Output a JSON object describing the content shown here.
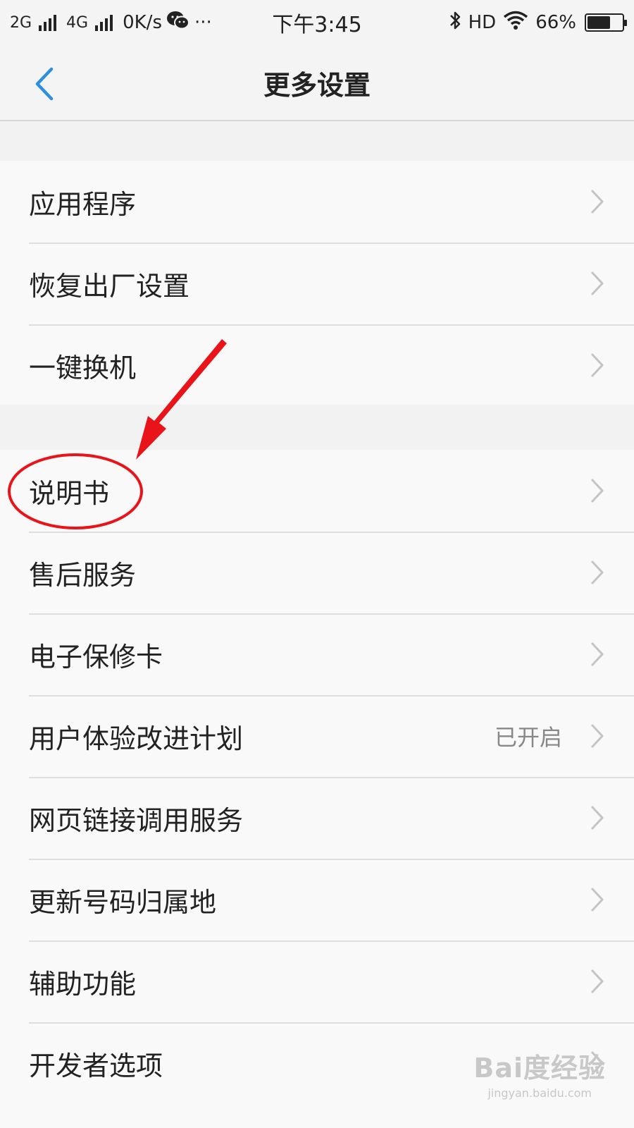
{
  "status_bar": {
    "net1": "2G",
    "net2": "4G",
    "speed": "0K/s",
    "more": "···",
    "time": "下午3:45",
    "hd": "HD",
    "battery_text": "66%",
    "battery_level": 0.66,
    "icons": [
      "signal-icon",
      "wechat-icon",
      "bluetooth-icon",
      "wifi-icon",
      "battery-icon"
    ]
  },
  "header": {
    "title": "更多设置",
    "back_icon": "chevron-left-icon",
    "accent_color": "#2f8fdc"
  },
  "group1": {
    "items": [
      {
        "label": "应用程序",
        "value": ""
      },
      {
        "label": "恢复出厂设置",
        "value": ""
      },
      {
        "label": "一键换机",
        "value": ""
      }
    ]
  },
  "group2": {
    "items": [
      {
        "label": "说明书",
        "value": ""
      },
      {
        "label": "售后服务",
        "value": ""
      },
      {
        "label": "电子保修卡",
        "value": ""
      },
      {
        "label": "用户体验改进计划",
        "value": "已开启"
      },
      {
        "label": "网页链接调用服务",
        "value": ""
      },
      {
        "label": "更新号码归属地",
        "value": ""
      },
      {
        "label": "辅助功能",
        "value": ""
      },
      {
        "label": "开发者选项",
        "value": ""
      }
    ]
  },
  "annotation": {
    "color": "#e8141a",
    "shapes": [
      "arrow",
      "circle"
    ]
  },
  "watermark": {
    "brand": "Bai度经验",
    "url": "jingyan.baidu.com"
  }
}
